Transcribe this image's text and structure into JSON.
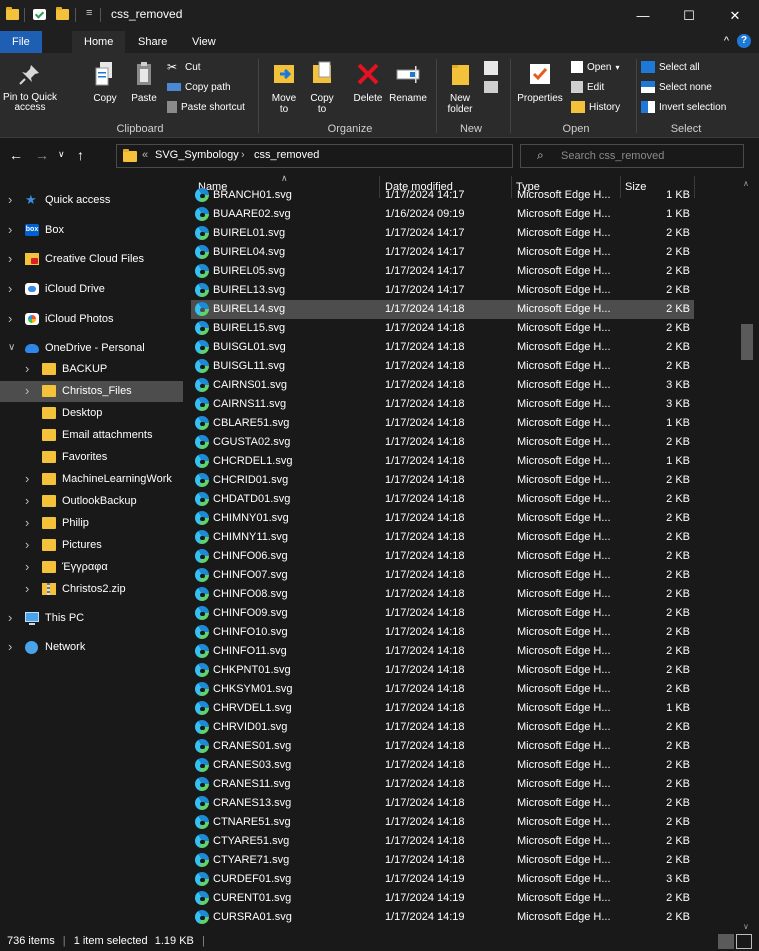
{
  "window": {
    "title": "css_removed",
    "minimize": "—",
    "maximize": "☐",
    "close": "✕"
  },
  "ribbon_tabs": {
    "file": "File",
    "home": "Home",
    "share": "Share",
    "view": "View",
    "collapse": "^",
    "help": "?"
  },
  "ribbon": {
    "pin_label": "Pin to Quick access",
    "copy": "Copy",
    "paste": "Paste",
    "cut": "Cut",
    "copy_path": "Copy path",
    "paste_shortcut": "Paste shortcut",
    "clipboard": "Clipboard",
    "move_to": "Move to",
    "copy_to": "Copy to",
    "delete": "Delete",
    "rename": "Rename",
    "organize": "Organize",
    "new_folder": "New folder",
    "new": "New",
    "properties": "Properties",
    "open": "Open",
    "edit": "Edit",
    "history": "History",
    "open_group": "Open",
    "select_all": "Select all",
    "select_none": "Select none",
    "invert_selection": "Invert selection",
    "select_group": "Select"
  },
  "address": {
    "crumb_overflow": "«",
    "crumbs": [
      "SVG_Symbology",
      "css_removed"
    ],
    "separator": "›",
    "search_placeholder": "Search css_removed"
  },
  "nav": [
    {
      "label": "Quick access",
      "icon": "star-icon"
    },
    {
      "label": "Box",
      "icon": "box-icon"
    },
    {
      "label": "Creative Cloud Files",
      "icon": "creative-cloud-icon"
    },
    {
      "label": "iCloud Drive",
      "icon": "icloud-icon"
    },
    {
      "label": "iCloud Photos",
      "icon": "icloud-photos-icon"
    },
    {
      "label": "OneDrive - Personal",
      "icon": "onedrive-icon"
    },
    {
      "label": "BACKUP",
      "icon": "folder-icon"
    },
    {
      "label": "Christos_Files",
      "icon": "folder-icon"
    },
    {
      "label": "Desktop",
      "icon": "folder-icon"
    },
    {
      "label": "Email attachments",
      "icon": "folder-icon"
    },
    {
      "label": "Favorites",
      "icon": "folder-icon"
    },
    {
      "label": "MachineLearningWork",
      "icon": "folder-icon"
    },
    {
      "label": "OutlookBackup",
      "icon": "folder-icon"
    },
    {
      "label": "Philip",
      "icon": "folder-icon"
    },
    {
      "label": "Pictures",
      "icon": "folder-icon"
    },
    {
      "label": "Έγγραφα",
      "icon": "folder-icon"
    },
    {
      "label": "Christos2.zip",
      "icon": "zip-icon"
    },
    {
      "label": "This PC",
      "icon": "pc-icon"
    },
    {
      "label": "Network",
      "icon": "network-icon"
    }
  ],
  "columns": {
    "name": "Name",
    "date": "Date modified",
    "type": "Type",
    "size": "Size"
  },
  "files": [
    {
      "name": "BRANCH01.svg",
      "date": "1/17/2024 14:17",
      "type": "Microsoft Edge H...",
      "size": "1 KB"
    },
    {
      "name": "BUAARE02.svg",
      "date": "1/16/2024 09:19",
      "type": "Microsoft Edge H...",
      "size": "1 KB"
    },
    {
      "name": "BUIREL01.svg",
      "date": "1/17/2024 14:17",
      "type": "Microsoft Edge H...",
      "size": "2 KB"
    },
    {
      "name": "BUIREL04.svg",
      "date": "1/17/2024 14:17",
      "type": "Microsoft Edge H...",
      "size": "2 KB"
    },
    {
      "name": "BUIREL05.svg",
      "date": "1/17/2024 14:17",
      "type": "Microsoft Edge H...",
      "size": "2 KB"
    },
    {
      "name": "BUIREL13.svg",
      "date": "1/17/2024 14:17",
      "type": "Microsoft Edge H...",
      "size": "2 KB"
    },
    {
      "name": "BUIREL14.svg",
      "date": "1/17/2024 14:18",
      "type": "Microsoft Edge H...",
      "size": "2 KB"
    },
    {
      "name": "BUIREL15.svg",
      "date": "1/17/2024 14:18",
      "type": "Microsoft Edge H...",
      "size": "2 KB"
    },
    {
      "name": "BUISGL01.svg",
      "date": "1/17/2024 14:18",
      "type": "Microsoft Edge H...",
      "size": "2 KB"
    },
    {
      "name": "BUISGL11.svg",
      "date": "1/17/2024 14:18",
      "type": "Microsoft Edge H...",
      "size": "2 KB"
    },
    {
      "name": "CAIRNS01.svg",
      "date": "1/17/2024 14:18",
      "type": "Microsoft Edge H...",
      "size": "3 KB"
    },
    {
      "name": "CAIRNS11.svg",
      "date": "1/17/2024 14:18",
      "type": "Microsoft Edge H...",
      "size": "3 KB"
    },
    {
      "name": "CBLARE51.svg",
      "date": "1/17/2024 14:18",
      "type": "Microsoft Edge H...",
      "size": "1 KB"
    },
    {
      "name": "CGUSTA02.svg",
      "date": "1/17/2024 14:18",
      "type": "Microsoft Edge H...",
      "size": "2 KB"
    },
    {
      "name": "CHCRDEL1.svg",
      "date": "1/17/2024 14:18",
      "type": "Microsoft Edge H...",
      "size": "1 KB"
    },
    {
      "name": "CHCRID01.svg",
      "date": "1/17/2024 14:18",
      "type": "Microsoft Edge H...",
      "size": "2 KB"
    },
    {
      "name": "CHDATD01.svg",
      "date": "1/17/2024 14:18",
      "type": "Microsoft Edge H...",
      "size": "2 KB"
    },
    {
      "name": "CHIMNY01.svg",
      "date": "1/17/2024 14:18",
      "type": "Microsoft Edge H...",
      "size": "2 KB"
    },
    {
      "name": "CHIMNY11.svg",
      "date": "1/17/2024 14:18",
      "type": "Microsoft Edge H...",
      "size": "2 KB"
    },
    {
      "name": "CHINFO06.svg",
      "date": "1/17/2024 14:18",
      "type": "Microsoft Edge H...",
      "size": "2 KB"
    },
    {
      "name": "CHINFO07.svg",
      "date": "1/17/2024 14:18",
      "type": "Microsoft Edge H...",
      "size": "2 KB"
    },
    {
      "name": "CHINFO08.svg",
      "date": "1/17/2024 14:18",
      "type": "Microsoft Edge H...",
      "size": "2 KB"
    },
    {
      "name": "CHINFO09.svg",
      "date": "1/17/2024 14:18",
      "type": "Microsoft Edge H...",
      "size": "2 KB"
    },
    {
      "name": "CHINFO10.svg",
      "date": "1/17/2024 14:18",
      "type": "Microsoft Edge H...",
      "size": "2 KB"
    },
    {
      "name": "CHINFO11.svg",
      "date": "1/17/2024 14:18",
      "type": "Microsoft Edge H...",
      "size": "2 KB"
    },
    {
      "name": "CHKPNT01.svg",
      "date": "1/17/2024 14:18",
      "type": "Microsoft Edge H...",
      "size": "2 KB"
    },
    {
      "name": "CHKSYM01.svg",
      "date": "1/17/2024 14:18",
      "type": "Microsoft Edge H...",
      "size": "2 KB"
    },
    {
      "name": "CHRVDEL1.svg",
      "date": "1/17/2024 14:18",
      "type": "Microsoft Edge H...",
      "size": "1 KB"
    },
    {
      "name": "CHRVID01.svg",
      "date": "1/17/2024 14:18",
      "type": "Microsoft Edge H...",
      "size": "2 KB"
    },
    {
      "name": "CRANES01.svg",
      "date": "1/17/2024 14:18",
      "type": "Microsoft Edge H...",
      "size": "2 KB"
    },
    {
      "name": "CRANES03.svg",
      "date": "1/17/2024 14:18",
      "type": "Microsoft Edge H...",
      "size": "2 KB"
    },
    {
      "name": "CRANES11.svg",
      "date": "1/17/2024 14:18",
      "type": "Microsoft Edge H...",
      "size": "2 KB"
    },
    {
      "name": "CRANES13.svg",
      "date": "1/17/2024 14:18",
      "type": "Microsoft Edge H...",
      "size": "2 KB"
    },
    {
      "name": "CTNARE51.svg",
      "date": "1/17/2024 14:18",
      "type": "Microsoft Edge H...",
      "size": "2 KB"
    },
    {
      "name": "CTYARE51.svg",
      "date": "1/17/2024 14:18",
      "type": "Microsoft Edge H...",
      "size": "2 KB"
    },
    {
      "name": "CTYARE71.svg",
      "date": "1/17/2024 14:18",
      "type": "Microsoft Edge H...",
      "size": "2 KB"
    },
    {
      "name": "CURDEF01.svg",
      "date": "1/17/2024 14:19",
      "type": "Microsoft Edge H...",
      "size": "3 KB"
    },
    {
      "name": "CURENT01.svg",
      "date": "1/17/2024 14:19",
      "type": "Microsoft Edge H...",
      "size": "2 KB"
    },
    {
      "name": "CURSRA01.svg",
      "date": "1/17/2024 14:19",
      "type": "Microsoft Edge H...",
      "size": "2 KB"
    }
  ],
  "status": {
    "item_count": "736 items",
    "selected": "1 item selected",
    "selected_size": "1.19 KB"
  },
  "colors": {
    "accent": "#1e5eb3",
    "folder": "#f3c13a",
    "selected_row": "#4d4d4d",
    "background": "#191919"
  }
}
